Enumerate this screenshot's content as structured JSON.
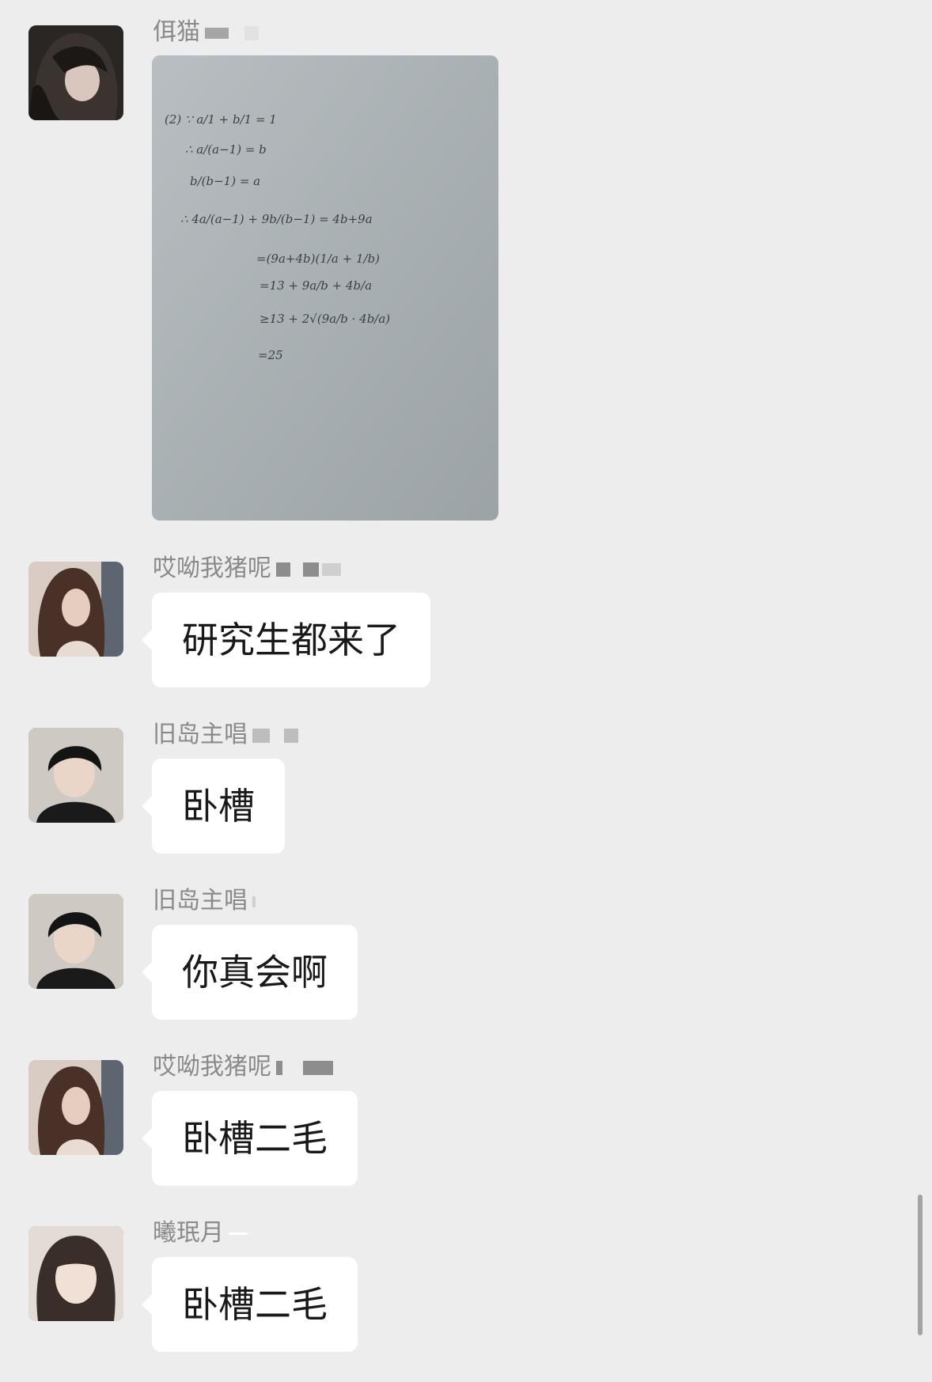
{
  "messages": [
    {
      "sender": "佴猫",
      "type": "image",
      "image_alt": "手写数学解题照片"
    },
    {
      "sender": "哎呦我猪呢",
      "type": "text",
      "text": "研究生都来了"
    },
    {
      "sender": "旧岛主唱",
      "type": "text",
      "text": "卧槽"
    },
    {
      "sender": "旧岛主唱",
      "type": "text",
      "text": "你真会啊"
    },
    {
      "sender": "哎呦我猪呢",
      "type": "text",
      "text": "卧槽二毛"
    },
    {
      "sender": "曦珉月",
      "type": "text",
      "text": "卧槽二毛"
    }
  ],
  "handwriting": [
    "(2) ∵ a/1 + b/1 = 1",
    "∴ a/(a−1) = b",
    "b/(b−1) = a",
    "∴ 4a/(a−1) + 9b/(b−1) = 4b+9a",
    "=(9a+4b)(1/a + 1/b)",
    "=13 + 9a/b + 4b/a",
    "≥13 + 2√(9a/b · 4b/a)",
    "=25"
  ],
  "colors": {
    "background": "#ededed",
    "bubble": "#ffffff",
    "sender_text": "#8a8a8a",
    "message_text": "#191919",
    "paper": "#a9b0b4"
  },
  "icons": {
    "avatar_1": "girl-dark-hair-avatar",
    "avatar_2": "girl-long-hair-avatar",
    "avatar_3": "boy-black-hair-avatar",
    "avatar_4": "girl-bangs-avatar"
  }
}
